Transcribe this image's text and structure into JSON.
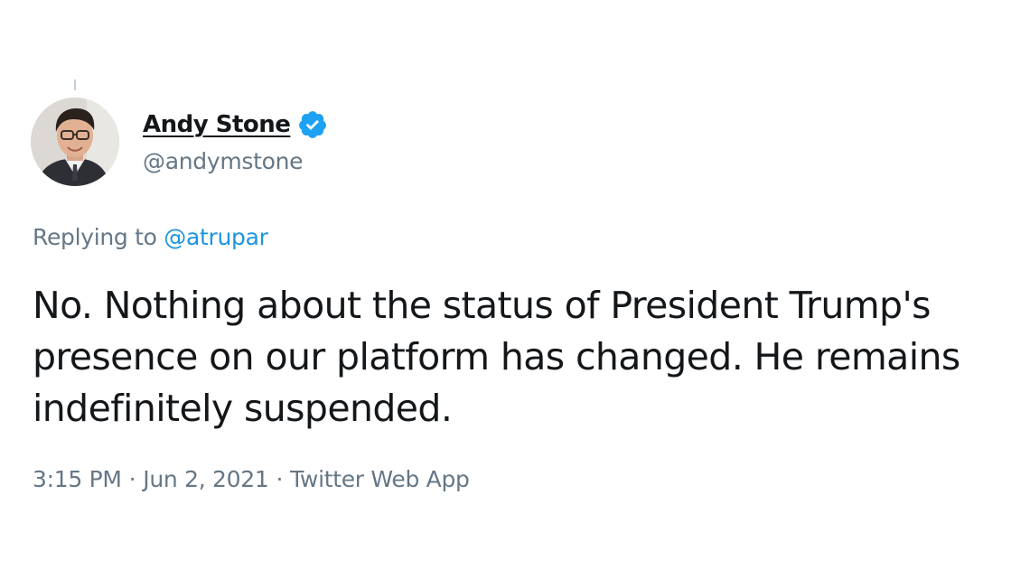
{
  "tweet": {
    "author": {
      "name": "Andy Stone",
      "handle": "@andymstone",
      "verified": true,
      "avatar_icon": "profile-photo"
    },
    "replying_to": {
      "prefix": "Replying to",
      "handle": "@atrupar"
    },
    "text": "No. Nothing about the status of President Trump's presence on our platform has changed. He remains indefinitely suspended.",
    "meta": {
      "time": "3:15 PM",
      "separator": "·",
      "date": "Jun 2, 2021",
      "source": "Twitter Web App"
    }
  },
  "colors": {
    "text_primary": "#14171a",
    "text_secondary": "#657786",
    "link": "#1b95e0",
    "verified_badge": "#1da1f2",
    "background": "#ffffff"
  }
}
